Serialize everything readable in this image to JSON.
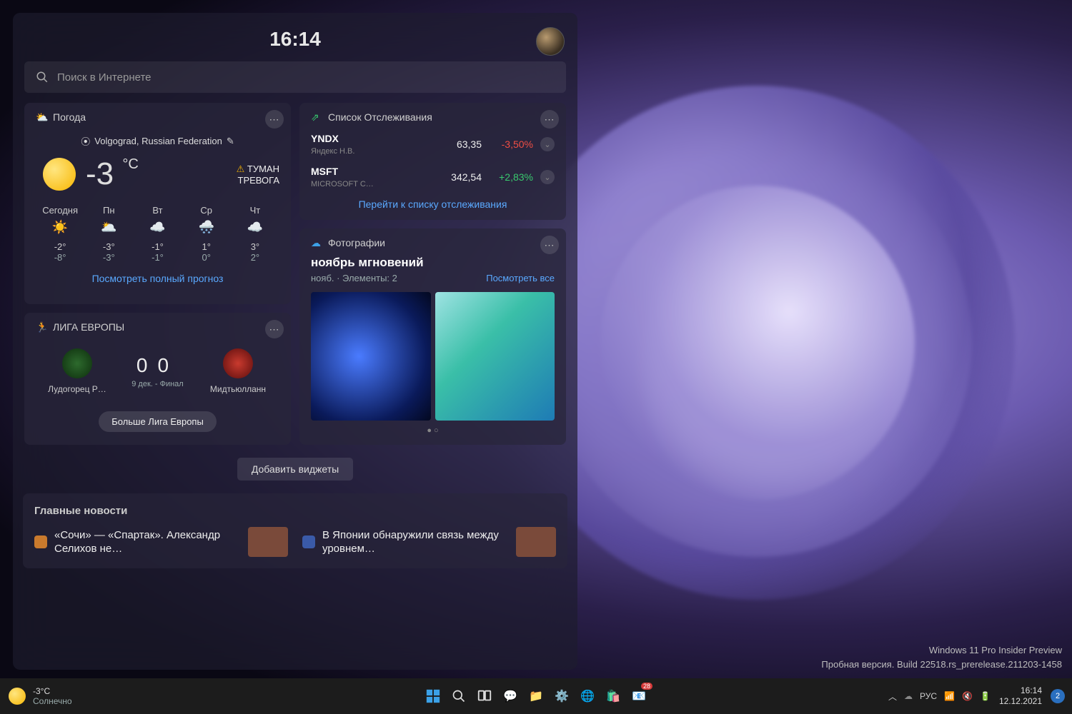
{
  "header": {
    "time": "16:14"
  },
  "search": {
    "placeholder": "Поиск в Интернете"
  },
  "weather": {
    "widget_title": "Погода",
    "location": "Volgograd, Russian Federation",
    "temp": "-3",
    "unit": "°C",
    "alert_line1": "ТУМАН",
    "alert_line2": "ТРЕВОГА",
    "forecast": [
      {
        "label": "Сегодня",
        "icon": "☀️",
        "hi": "-2°",
        "lo": "-8°"
      },
      {
        "label": "Пн",
        "icon": "🌥️",
        "hi": "-3°",
        "lo": "-3°"
      },
      {
        "label": "Вт",
        "icon": "☁️",
        "hi": "-1°",
        "lo": "-1°"
      },
      {
        "label": "Ср",
        "icon": "🌨️",
        "hi": "1°",
        "lo": "0°"
      },
      {
        "label": "Чт",
        "icon": "☁️",
        "hi": "3°",
        "lo": "2°"
      }
    ],
    "link": "Посмотреть полный прогноз"
  },
  "stocks": {
    "widget_title": "Список Отслеживания",
    "rows": [
      {
        "sym": "YNDX",
        "name": "Яндекс Н.В.",
        "price": "63,35",
        "change": "-3,50%",
        "dir": "down"
      },
      {
        "sym": "MSFT",
        "name": "MICROSOFT C…",
        "price": "342,54",
        "change": "+2,83%",
        "dir": "up"
      }
    ],
    "link": "Перейти к списку отслеживания"
  },
  "photos": {
    "widget_title": "Фотографии",
    "title": "ноябрь мгновений",
    "meta": "нояб. · Элементы: 2",
    "see_all": "Посмотреть все"
  },
  "sports": {
    "widget_title": "ЛИГА ЕВРОПЫ",
    "team1": "Лудогорец Р…",
    "team2": "Мидтьюлланн",
    "score1": "0",
    "score2": "0",
    "final": "9 дек. - Финал",
    "more": "Больше Лига Европы"
  },
  "add_widgets": "Добавить виджеты",
  "news": {
    "heading": "Главные новости",
    "items": [
      {
        "text": "«Сочи» — «Спартак». Александр Селихов не…"
      },
      {
        "text": "В Японии обнаружили связь между уровнем…"
      }
    ]
  },
  "watermark": {
    "line1": "Windows 11 Pro Insider Preview",
    "line2": "Пробная версия. Build 22518.rs_prerelease.211203-1458"
  },
  "taskbar": {
    "weather_temp": "-3°C",
    "weather_cond": "Солнечно",
    "lang": "РУС",
    "time": "16:14",
    "date": "12.12.2021",
    "notif_count": "2",
    "calendar_badge": "28"
  }
}
